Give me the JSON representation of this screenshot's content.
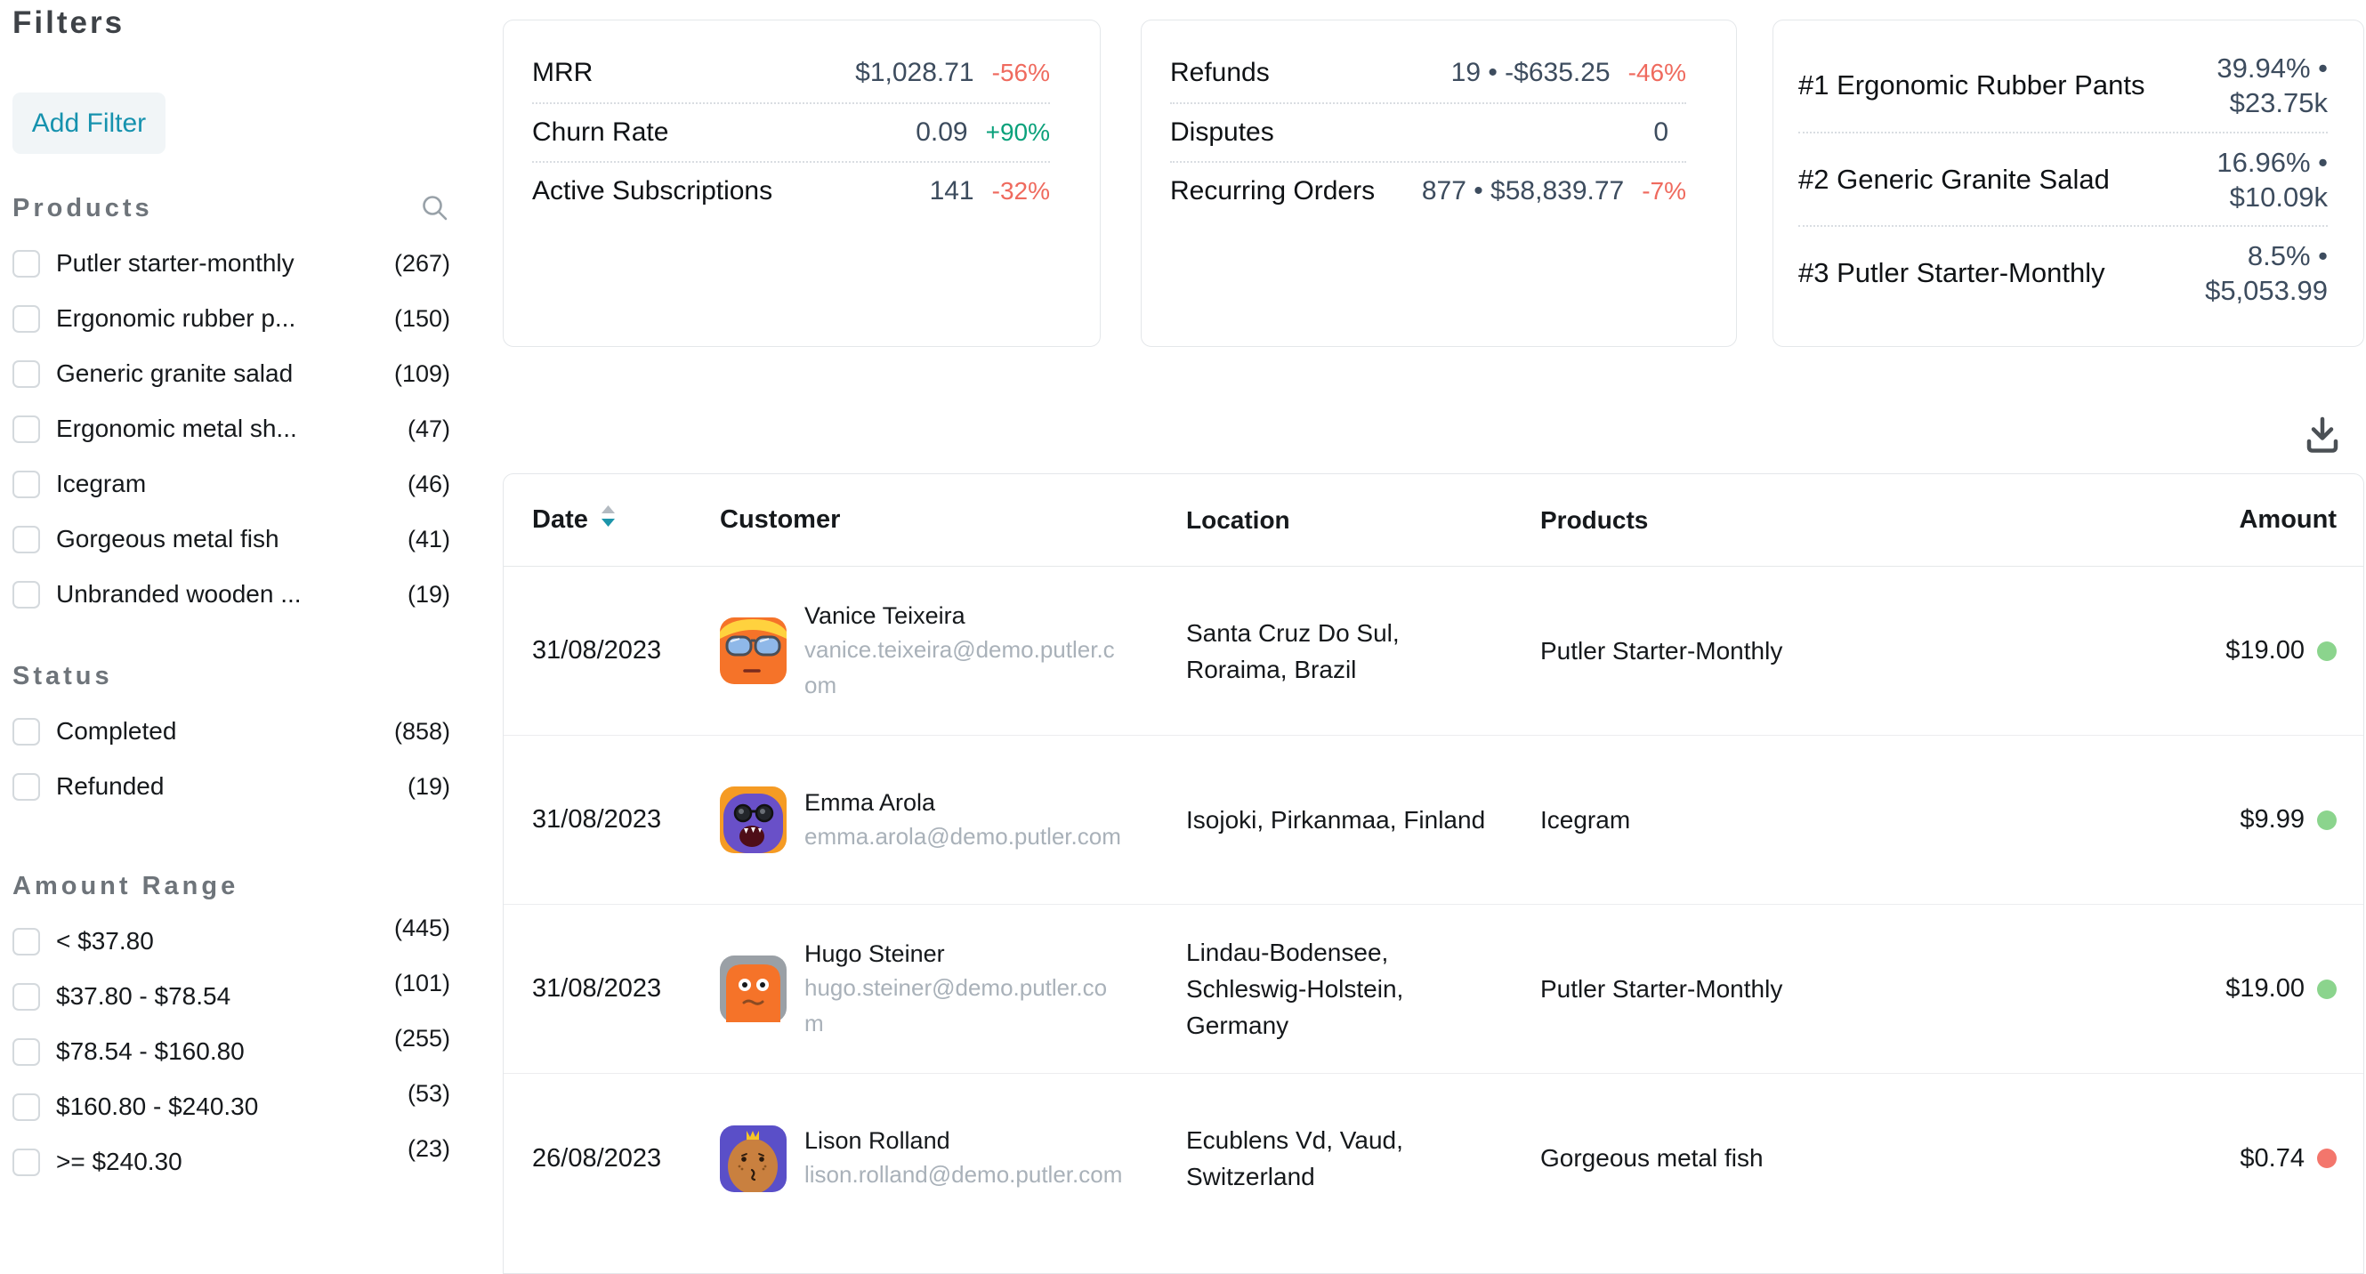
{
  "colors": {
    "accent_teal": "#1692ae",
    "negative_red": "#ef6a5e",
    "positive_green": "#0aa17b",
    "dot_completed_green": "#8bd48d",
    "dot_refunded_red": "#f3766c"
  },
  "sidebar": {
    "title": "Filters",
    "add_filter": "Add Filter",
    "sections": [
      {
        "title": "Products",
        "items": [
          {
            "label": "Putler starter-monthly",
            "count": "(267)"
          },
          {
            "label": "Ergonomic rubber p...",
            "count": "(150)"
          },
          {
            "label": "Generic granite salad",
            "count": "(109)"
          },
          {
            "label": "Ergonomic metal sh...",
            "count": "(47)"
          },
          {
            "label": "Icegram",
            "count": "(46)"
          },
          {
            "label": "Gorgeous metal fish",
            "count": "(41)"
          },
          {
            "label": "Unbranded wooden ...",
            "count": "(19)"
          }
        ]
      },
      {
        "title": "Status",
        "items": [
          {
            "label": "Completed",
            "count": "(858)"
          },
          {
            "label": "Refunded",
            "count": "(19)"
          }
        ]
      },
      {
        "title": "Amount Range",
        "items": [
          {
            "label": "< $37.80",
            "count": "(445)"
          },
          {
            "label": "$37.80 - $78.54",
            "count": "(101)"
          },
          {
            "label": "$78.54 - $160.80",
            "count": "(255)"
          },
          {
            "label": "$160.80 - $240.30",
            "count": "(53)"
          },
          {
            "label": ">= $240.30",
            "count": "(23)"
          }
        ]
      }
    ]
  },
  "cards": [
    {
      "rows": [
        {
          "label": "MRR",
          "value": "$1,028.71",
          "delta": "-56%",
          "delta_color": "#ef6a5e"
        },
        {
          "label": "Churn Rate",
          "value": "0.09",
          "delta": "+90%",
          "delta_color": "#0aa17b"
        },
        {
          "label": "Active Subscriptions",
          "value": "141",
          "delta": "-32%",
          "delta_color": "#ef6a5e"
        }
      ]
    },
    {
      "rows": [
        {
          "label": "Refunds",
          "value": "19 • -$635.25",
          "delta": "-46%",
          "delta_color": "#ef6a5e"
        },
        {
          "label": "Disputes",
          "value": "0",
          "delta": ""
        },
        {
          "label": "Recurring Orders",
          "value": "877 • $58,839.77",
          "delta": "-7%",
          "delta_color": "#ef6a5e"
        }
      ]
    },
    {
      "rows": [
        {
          "label": "#1 Ergonomic Rubber Pants",
          "pct_line": "39.94% •",
          "amt_line": "$23.75k"
        },
        {
          "label": "#2 Generic Granite Salad",
          "pct_line": "16.96% •",
          "amt_line": "$10.09k"
        },
        {
          "label": "#3 Putler Starter-Monthly",
          "pct_line": "8.5% •",
          "amt_line": "$5,053.99"
        }
      ]
    }
  ],
  "table": {
    "columns": [
      "Date",
      "Customer",
      "Location",
      "Products",
      "Amount"
    ],
    "rows": [
      {
        "date": "31/08/2023",
        "name": "Vanice Teixeira",
        "email": "vanice.teixeira@demo.putler.com",
        "location": "Santa Cruz Do Sul, Roraima, Brazil",
        "product": "Putler Starter-Monthly",
        "amount": "$19.00",
        "dot_color": "#8bd48d"
      },
      {
        "date": "31/08/2023",
        "name": "Emma Arola",
        "email": "emma.arola@demo.putler.com",
        "location": "Isojoki, Pirkanmaa, Finland",
        "product": "Icegram",
        "amount": "$9.99",
        "dot_color": "#8bd48d"
      },
      {
        "date": "31/08/2023",
        "name": "Hugo Steiner",
        "email": "hugo.steiner@demo.putler.com",
        "location": "Lindau-Bodensee, Schleswig-Holstein, Germany",
        "product": "Putler Starter-Monthly",
        "amount": "$19.00",
        "dot_color": "#8bd48d"
      },
      {
        "date": "26/08/2023",
        "name": "Lison Rolland",
        "email": "lison.rolland@demo.putler.com",
        "location": "Ecublens Vd, Vaud, Switzerland",
        "product": "Gorgeous metal fish",
        "amount": "$0.74",
        "dot_color": "#f3766c"
      }
    ]
  }
}
